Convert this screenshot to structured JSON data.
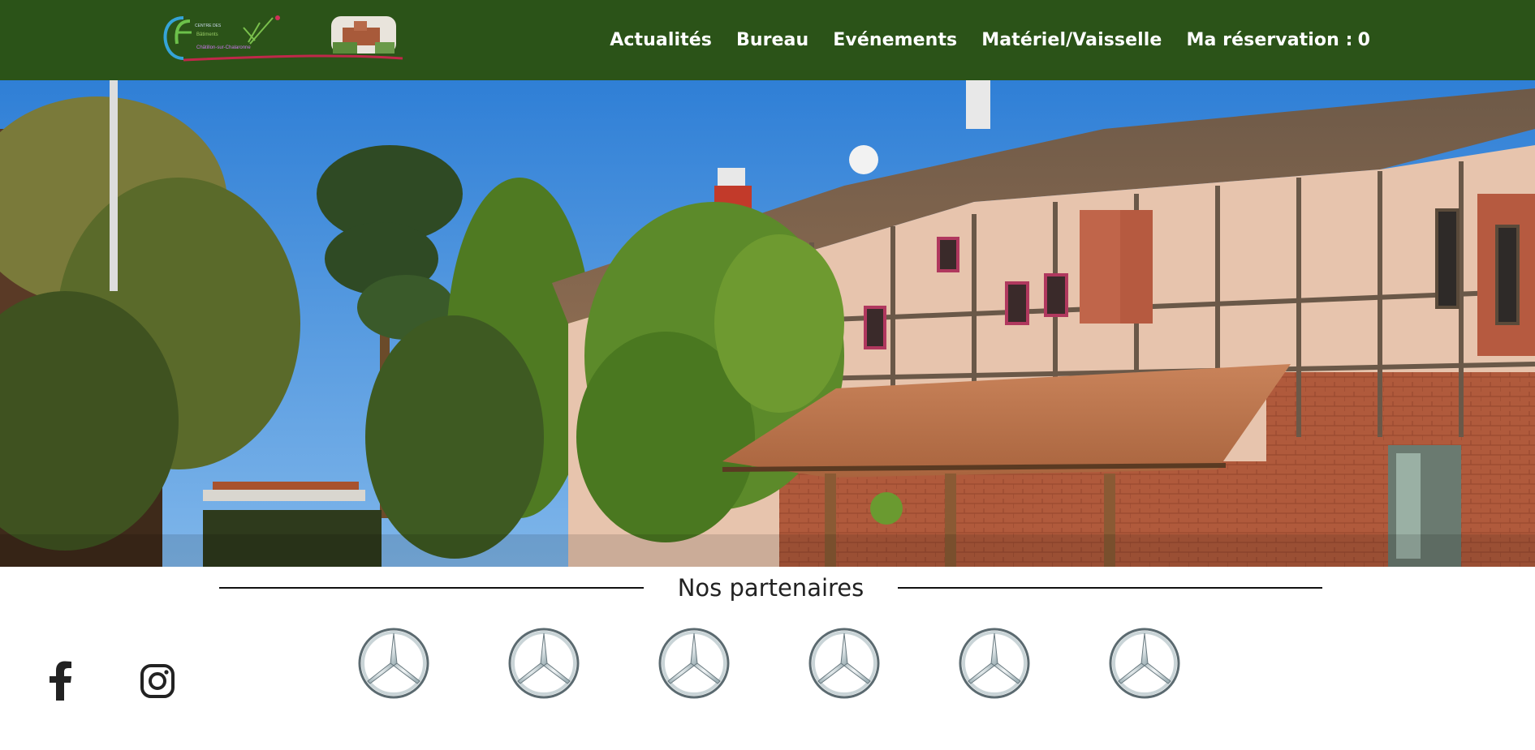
{
  "header": {
    "logo_name": "site-logo",
    "nav": [
      {
        "label": "Actualités"
      },
      {
        "label": "Bureau"
      },
      {
        "label": "Evénements"
      },
      {
        "label": "Matériel/Vaisselle"
      }
    ],
    "reservation": {
      "label": "Ma réservation :",
      "count": "0"
    },
    "background_color": "#2b5318"
  },
  "hero": {
    "image": "village-half-timbered-house-photo"
  },
  "partners": {
    "title": "Nos partenaires",
    "logos": [
      {
        "icon": "mercedes-star-logo"
      },
      {
        "icon": "mercedes-star-logo"
      },
      {
        "icon": "mercedes-star-logo"
      },
      {
        "icon": "mercedes-star-logo"
      },
      {
        "icon": "mercedes-star-logo"
      },
      {
        "icon": "mercedes-star-logo"
      }
    ]
  },
  "social": [
    {
      "icon": "facebook-icon"
    },
    {
      "icon": "instagram-icon"
    }
  ]
}
